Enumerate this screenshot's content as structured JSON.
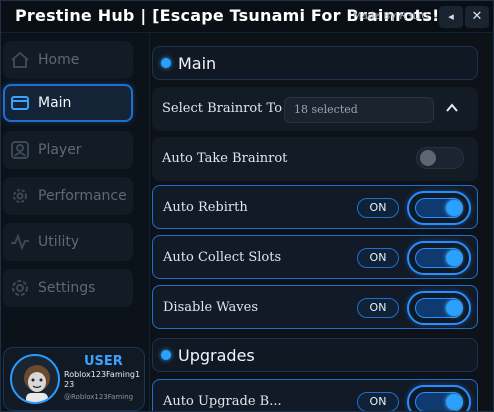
{
  "window": {
    "title": "Prestine Hub | [Escape Tsunami For Brainrots!]",
    "made_by": "Made By R3LIG",
    "minimize_glyph": "◂",
    "close_glyph": "✕"
  },
  "sidebar": {
    "items": [
      {
        "label": "Home",
        "icon": "home-icon",
        "active": false
      },
      {
        "label": "Main",
        "icon": "main-window-icon",
        "active": true
      },
      {
        "label": "Player",
        "icon": "player-icon",
        "active": false
      },
      {
        "label": "Performance",
        "icon": "gear-icon",
        "active": false
      },
      {
        "label": "Utility",
        "icon": "pulse-icon",
        "active": false
      },
      {
        "label": "Settings",
        "icon": "settings-icon",
        "active": false
      }
    ]
  },
  "user": {
    "title": "USER",
    "display_name": "Roblox123Faming123",
    "handle": "@Roblox123Faming"
  },
  "main": {
    "section_main": "Main",
    "dropdown": {
      "label": "Select Brainrot To Take",
      "value": "18 selected"
    },
    "rows": [
      {
        "label": "Auto Take Brainrot",
        "state": "off",
        "badge": ""
      },
      {
        "label": "Auto Rebirth",
        "state": "on",
        "badge": "ON"
      },
      {
        "label": "Auto Collect Slots",
        "state": "on",
        "badge": "ON"
      },
      {
        "label": "Disable Waves",
        "state": "on",
        "badge": "ON"
      }
    ],
    "section_upgrades": "Upgrades",
    "upgrades_row": {
      "label": "Auto Upgrade B...",
      "badge": "ON"
    }
  },
  "colors": {
    "accent": "#2aa0ff",
    "accent_border": "#1f6fcf",
    "background": "#0c1219"
  }
}
